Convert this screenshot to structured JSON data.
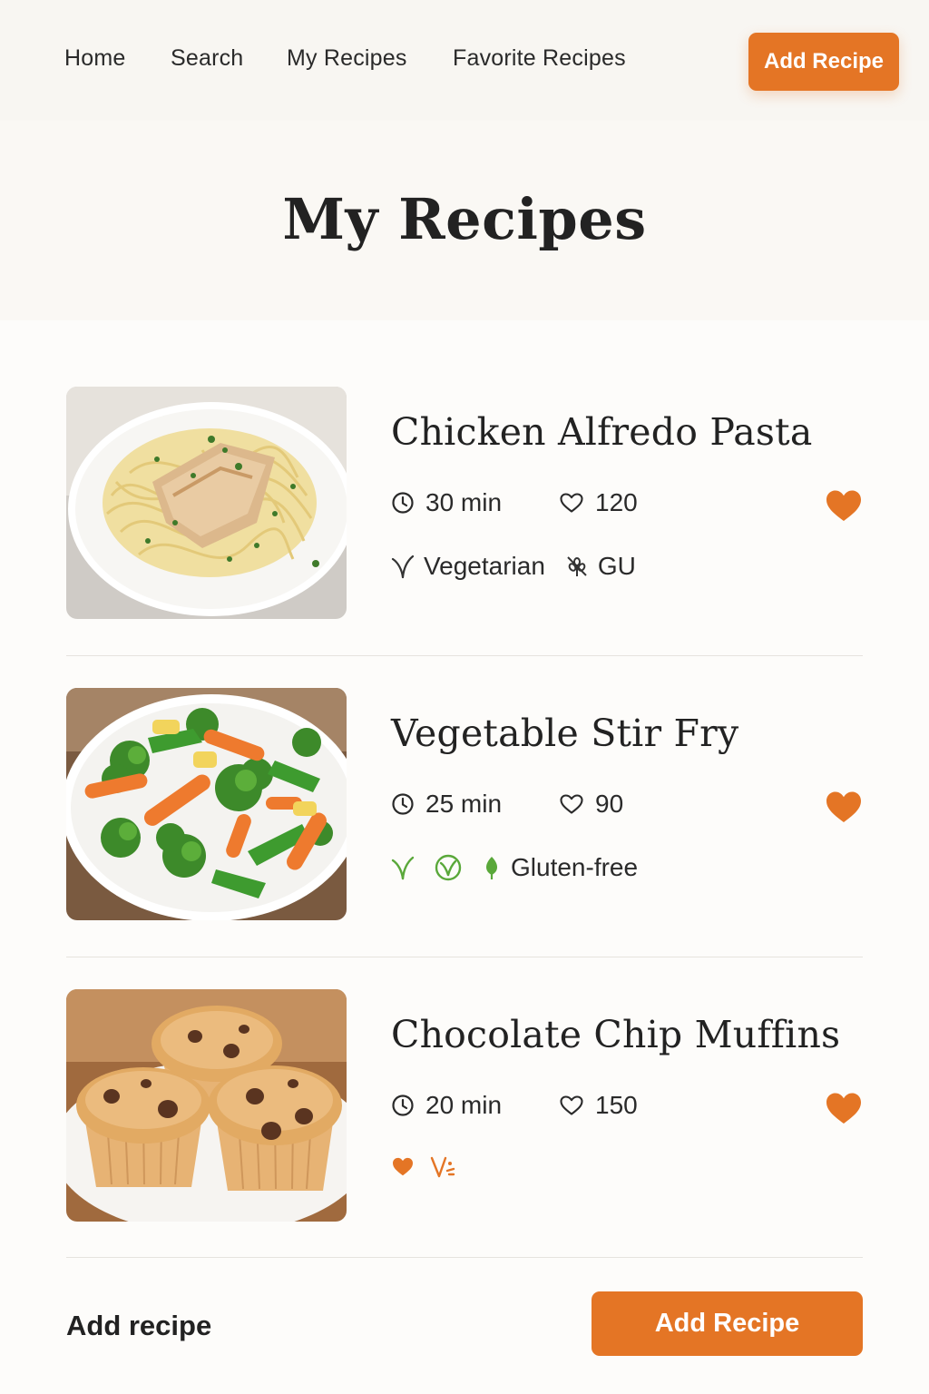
{
  "nav": {
    "links": [
      "Home",
      "Search",
      "My Recipes",
      "Favorite Recipes"
    ],
    "add_label": "Add Recipe"
  },
  "page": {
    "title": "My Recipes"
  },
  "recipes": [
    {
      "title": "Chicken Alfredo Pasta",
      "time": "30 min",
      "likes": "120",
      "favorited": true,
      "tags": [
        {
          "icon": "leaf-icon",
          "label": "Vegetarian"
        },
        {
          "icon": "gluten-icon",
          "label": "GU"
        }
      ]
    },
    {
      "title": "Vegetable Stir Fry",
      "time": "25 min",
      "likes": "90",
      "favorited": true,
      "tags": [
        {
          "icon": "sprout-icon",
          "label": ""
        },
        {
          "icon": "vegan-badge-icon",
          "label": ""
        },
        {
          "icon": "leaf-icon",
          "label": "Gluten-free"
        }
      ]
    },
    {
      "title": "Chocolate Chip Muffins",
      "time": "20 min",
      "likes": "150",
      "favorited": true,
      "tags": [
        {
          "icon": "heart-icon",
          "label": ""
        },
        {
          "icon": "vegan-mark-icon",
          "label": ""
        }
      ]
    }
  ],
  "footer": {
    "label": "Add recipe",
    "button": "Add Recipe"
  },
  "colors": {
    "accent": "#e47525",
    "green": "#5aa83a",
    "text": "#222222"
  }
}
